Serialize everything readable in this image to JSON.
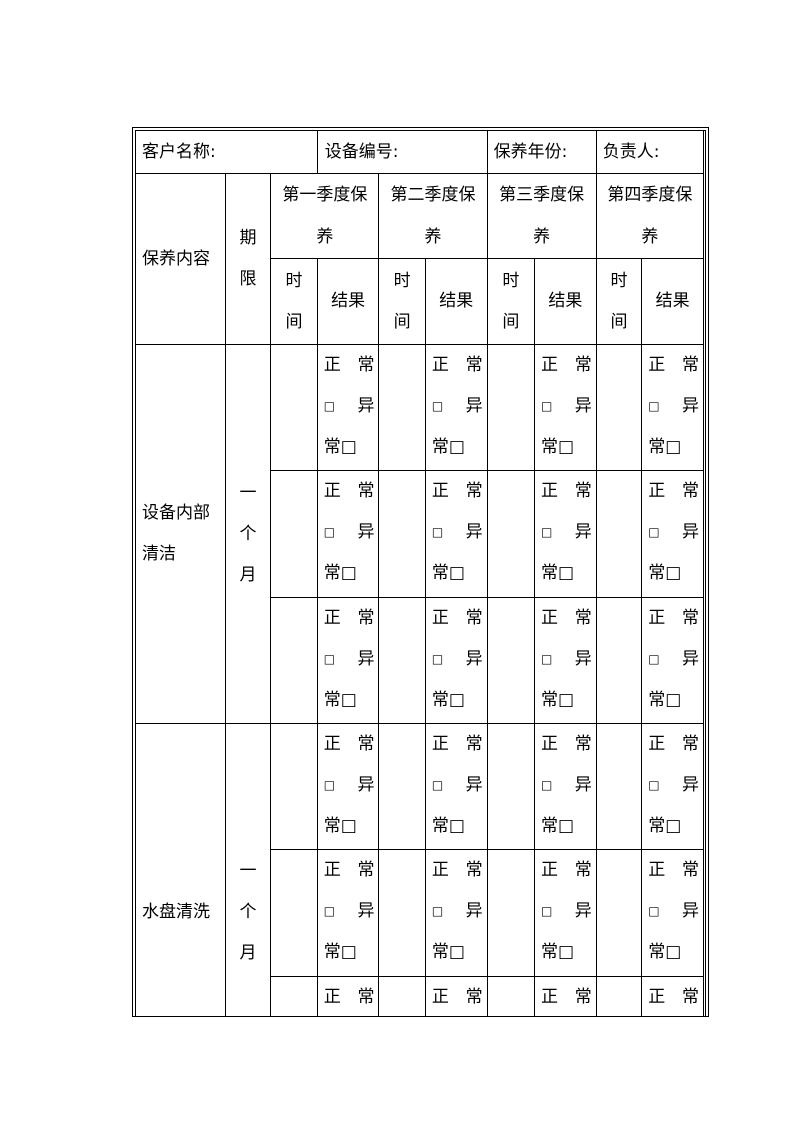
{
  "form": {
    "header_row": {
      "customer_name_label": "客户名称:",
      "equipment_no_label": "设备编号:",
      "maintenance_year_label": "保养年份:",
      "responsible_person_label": "负责人:"
    },
    "columns": {
      "content_label": "保养内容",
      "period_label_chars": [
        "期",
        "限"
      ],
      "quarters": [
        {
          "line1": "第一季度保",
          "line2": "养"
        },
        {
          "line1": "第二季度保",
          "line2": "养"
        },
        {
          "line1": "第三季度保",
          "line2": "养"
        },
        {
          "line1": "第四季度保",
          "line2": "养"
        }
      ],
      "time_label_chars": [
        "时",
        "间"
      ],
      "result_label": "结果"
    },
    "result_option": {
      "line1_a": "正",
      "line1_b": "常",
      "line2_a": "□",
      "line2_b": "异",
      "line3": "常□"
    },
    "sections": [
      {
        "content_lines": [
          "设备内部",
          "清洁"
        ],
        "period_chars": [
          "一",
          "个",
          "月"
        ],
        "row_count": 3
      },
      {
        "content_lines": [
          "水盘清洗"
        ],
        "period_chars": [
          "一",
          "个",
          "月"
        ],
        "row_count": 3
      }
    ]
  }
}
